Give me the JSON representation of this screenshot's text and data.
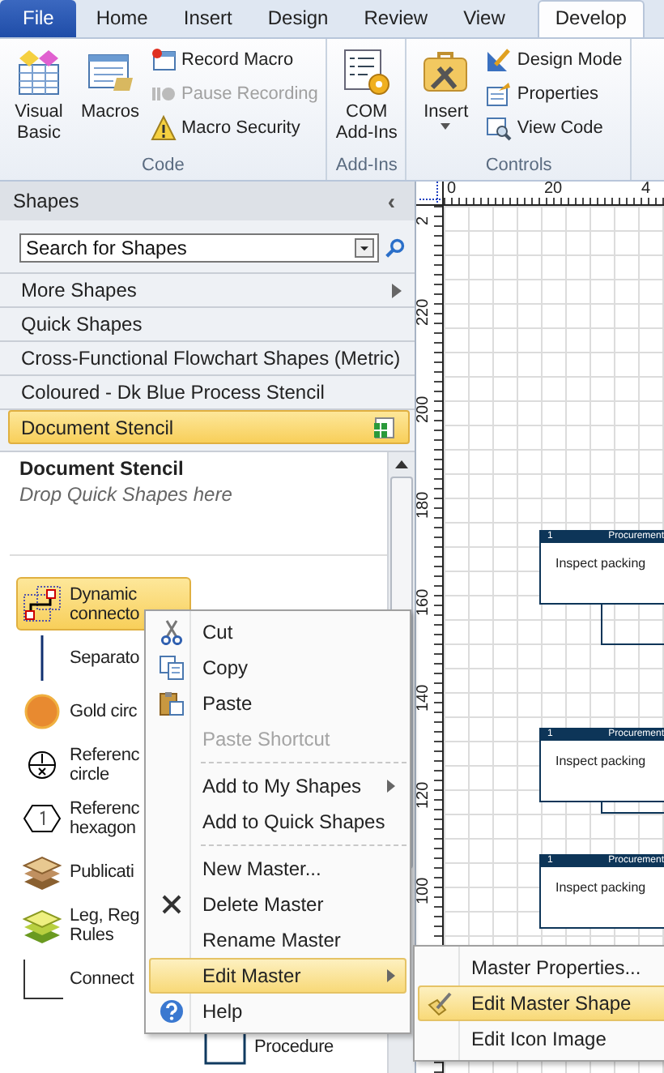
{
  "ribbon_tabs": [
    {
      "label": "File",
      "kind": "file",
      "selected": false
    },
    {
      "label": "Home",
      "kind": "tab",
      "selected": false
    },
    {
      "label": "Insert",
      "kind": "tab",
      "selected": false
    },
    {
      "label": "Design",
      "kind": "tab",
      "selected": false
    },
    {
      "label": "Review",
      "kind": "tab",
      "selected": false
    },
    {
      "label": "View",
      "kind": "tab",
      "selected": false
    },
    {
      "label": "Develop",
      "kind": "tab",
      "selected": true
    }
  ],
  "ribbon_groups": [
    {
      "label": "Code",
      "large_buttons": [
        {
          "label": "Visual Basic",
          "kind": "vb"
        },
        {
          "label": "Macros",
          "kind": "macros"
        }
      ],
      "small_buttons": [
        {
          "label": "Record Macro",
          "kind": "record",
          "disabled": false
        },
        {
          "label": "Pause Recording",
          "kind": "pause",
          "disabled": true
        },
        {
          "label": "Macro Security",
          "kind": "warning",
          "disabled": false
        }
      ]
    },
    {
      "label": "Add-Ins",
      "large_buttons": [
        {
          "label": "COM Add-Ins",
          "kind": "com"
        }
      ]
    },
    {
      "label": "Controls",
      "large_buttons": [
        {
          "label": "Insert",
          "kind": "tools"
        }
      ],
      "small_buttons": [
        {
          "label": "Design Mode",
          "kind": "design",
          "disabled": false
        },
        {
          "label": "Properties",
          "kind": "properties",
          "disabled": false
        },
        {
          "label": "View Code",
          "kind": "viewcode",
          "disabled": false
        }
      ]
    }
  ],
  "shapes_panel": {
    "title": "Shapes",
    "collapse": "‹",
    "search": {
      "placeholder": "Search for Shapes"
    },
    "stencils": [
      {
        "label": "More Shapes",
        "kind": "menu",
        "selected": false
      },
      {
        "label": "Quick Shapes",
        "kind": "stencil",
        "selected": false
      },
      {
        "label": "Cross-Functional Flowchart Shapes (Metric)",
        "kind": "stencil",
        "selected": false
      },
      {
        "label": "Coloured - Dk Blue Process Stencil",
        "kind": "stencil",
        "selected": false
      },
      {
        "label": "Document Stencil",
        "kind": "stencil",
        "selected": true
      }
    ],
    "stencil_title": "Document Stencil",
    "stencil_hint": "Drop Quick Shapes here",
    "masters": [
      {
        "label": "Dynamic\nconnecto",
        "kind": "connector",
        "selected": true
      },
      {
        "label": "Separato",
        "kind": "separator",
        "selected": false
      },
      {
        "label": "Gold circ",
        "kind": "gold",
        "selected": false
      },
      {
        "label": "Referenc\ncircle",
        "kind": "refcircle",
        "selected": false
      },
      {
        "label": "Referenc\nhexagon",
        "kind": "hexagon",
        "selected": false
      },
      {
        "label": "Publicati",
        "kind": "publication",
        "selected": false
      },
      {
        "label": "Leg, Reg\nRules",
        "kind": "rules",
        "selected": false
      },
      {
        "label": "Connect",
        "kind": "connect",
        "selected": false
      }
    ],
    "masters_column_2": [
      {
        "label": "Procedure",
        "kind": "process",
        "selected": false
      }
    ]
  },
  "canvas": {
    "top_ruler": [
      "0",
      "20",
      "4"
    ],
    "left_ruler": [
      "2",
      "220",
      "200",
      "180",
      "160",
      "140",
      "120",
      "100"
    ],
    "shapes": [
      {
        "number": "1",
        "lane": "Procurement",
        "label": "Inspect packing"
      },
      {
        "number": "1",
        "lane": "Procurement",
        "label": "Inspect packing"
      },
      {
        "number": "1",
        "lane": "Procurement",
        "label": "Inspect packing"
      }
    ]
  },
  "context_menu": {
    "items": [
      {
        "label": "Cut",
        "kind": "cut",
        "disabled": false,
        "submenu": false,
        "selected": false
      },
      {
        "label": "Copy",
        "kind": "copy",
        "disabled": false,
        "submenu": false,
        "selected": false
      },
      {
        "label": "Paste",
        "kind": "paste",
        "disabled": false,
        "submenu": false,
        "selected": false
      },
      {
        "label": "Paste Shortcut",
        "kind": "none",
        "disabled": true,
        "submenu": false,
        "selected": false
      },
      {
        "kind": "separator"
      },
      {
        "label": "Add to My Shapes",
        "kind": "none",
        "disabled": false,
        "submenu": true,
        "selected": false
      },
      {
        "label": "Add to Quick Shapes",
        "kind": "none",
        "disabled": false,
        "submenu": false,
        "selected": false
      },
      {
        "kind": "separator"
      },
      {
        "label": "New Master...",
        "kind": "none",
        "disabled": false,
        "submenu": false,
        "selected": false
      },
      {
        "label": "Delete Master",
        "kind": "delete",
        "disabled": false,
        "submenu": false,
        "selected": false
      },
      {
        "label": "Rename Master",
        "kind": "none",
        "disabled": false,
        "submenu": false,
        "selected": false
      },
      {
        "label": "Edit Master",
        "kind": "none",
        "disabled": false,
        "submenu": true,
        "selected": true
      },
      {
        "label": "Help",
        "kind": "help",
        "disabled": false,
        "submenu": false,
        "selected": false
      }
    ]
  },
  "submenu": {
    "items": [
      {
        "label": "Master Properties...",
        "kind": "none",
        "selected": false
      },
      {
        "label": "Edit Master Shape",
        "kind": "pencil",
        "selected": true
      },
      {
        "label": "Edit Icon Image",
        "kind": "none",
        "selected": false
      }
    ]
  }
}
